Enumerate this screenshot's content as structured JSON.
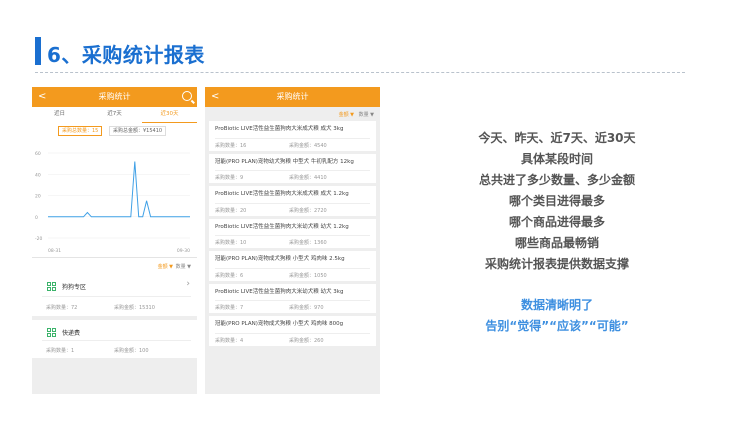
{
  "slide": {
    "title": "6、采购统计报表"
  },
  "phone1": {
    "app_title": "采购统计",
    "back_glyph": "<",
    "tabs": [
      "近日",
      "近7天",
      "近30天"
    ],
    "summary": {
      "qty_label": "采购总数量：15",
      "amount_label": "采购总金额：¥15410"
    },
    "chart_data": {
      "type": "line",
      "y_ticks": [
        "60",
        "40",
        "20",
        "0",
        "-20"
      ],
      "x_labels": [
        "08-31",
        "09-30"
      ],
      "ylim": [
        -20,
        60
      ],
      "values": [
        0,
        0,
        0,
        0,
        0,
        0,
        0,
        0,
        0,
        0,
        4,
        0,
        0,
        0,
        0,
        0,
        0,
        0,
        0,
        0,
        0,
        0,
        52,
        0,
        0,
        15,
        0,
        0,
        0,
        0,
        0,
        0,
        0,
        0,
        0,
        0,
        0
      ],
      "color": "#3fa0e6"
    },
    "sort": {
      "by_amount": "金额 ▼",
      "by_qty": "数量 ▼"
    },
    "categories": [
      {
        "name": "狗狗专区",
        "qty": "采购数量：72",
        "amount": "采购金额：15310"
      },
      {
        "name": "快递费",
        "qty": "采购数量：1",
        "amount": "采购金额：100"
      }
    ]
  },
  "phone2": {
    "app_title": "采购统计",
    "back_glyph": "<",
    "sort": {
      "by_amount": "金额 ▼",
      "by_qty": "数量 ▼"
    },
    "products": [
      {
        "name": "ProBiotic LIVE活性益生菌狗肉大米成犬粮 成犬 3kg",
        "qty": "采购数量：16",
        "amount": "采购金额：4540"
      },
      {
        "name": "冠能(PRO PLAN)宠物幼犬狗粮 中型犬 牛初乳配方 12kg",
        "qty": "采购数量：9",
        "amount": "采购金额：4410"
      },
      {
        "name": "ProBiotic LIVE活性益生菌狗肉大米成犬粮 成犬 1.2kg",
        "qty": "采购数量：20",
        "amount": "采购金额：2720"
      },
      {
        "name": "ProBiotic LIVE活性益生菌狗肉大米幼犬粮 幼犬 1.2kg",
        "qty": "采购数量：10",
        "amount": "采购金额：1360"
      },
      {
        "name": "冠能(PRO PLAN)宠物成犬狗粮 小型犬 鸡肉味 2.5kg",
        "qty": "采购数量：6",
        "amount": "采购金额：1050"
      },
      {
        "name": "ProBiotic LIVE活性益生菌狗肉大米幼犬粮 幼犬 3kg",
        "qty": "采购数量：7",
        "amount": "采购金额：970"
      },
      {
        "name": "冠能(PRO PLAN)宠物成犬狗粮 小型犬 鸡肉味 800g",
        "qty": "采购数量：4",
        "amount": "采购金额：260"
      }
    ]
  },
  "points": [
    "今天、昨天、近7天、近30天",
    "具体某段时间",
    "总共进了多少数量、多少金额",
    "哪个类目进得最多",
    "哪个商品进得最多",
    "哪些商品最畅销",
    "采购统计报表提供数据支撑"
  ],
  "conclusion": [
    "数据清晰明了",
    "告别“觉得”“应该”“可能”"
  ],
  "colors": {
    "accent": "#f39a1e",
    "title_blue": "#1a6fd0",
    "conclusion_blue": "#3d8fe0",
    "chart_line": "#3fa0e6"
  }
}
